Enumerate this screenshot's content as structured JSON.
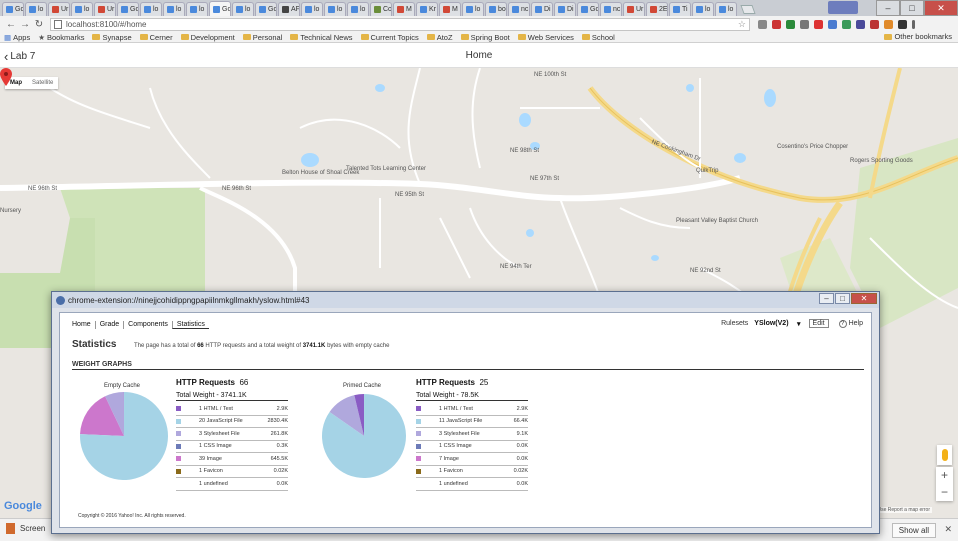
{
  "browser": {
    "tabs": [
      {
        "label": "Go",
        "color": "#4a89dc"
      },
      {
        "label": "lo",
        "color": "#4a89dc"
      },
      {
        "label": "Ur",
        "color": "#d14836"
      },
      {
        "label": "lo",
        "color": "#4a89dc"
      },
      {
        "label": "Ur",
        "color": "#d14836"
      },
      {
        "label": "Go",
        "color": "#4a89dc"
      },
      {
        "label": "lo",
        "color": "#4a89dc"
      },
      {
        "label": "lo",
        "color": "#4a89dc"
      },
      {
        "label": "lo",
        "color": "#4a89dc"
      },
      {
        "label": "Go",
        "color": "#4a89dc"
      },
      {
        "label": "lo",
        "color": "#4a89dc"
      },
      {
        "label": "Go",
        "color": "#4a89dc"
      },
      {
        "label": "AF",
        "color": "#444444"
      },
      {
        "label": "lo",
        "color": "#4a89dc"
      },
      {
        "label": "lo",
        "color": "#4a89dc"
      },
      {
        "label": "lo",
        "color": "#4a89dc"
      },
      {
        "label": "Co",
        "color": "#6a8e3a"
      },
      {
        "label": "M",
        "color": "#d14836"
      },
      {
        "label": "Kr",
        "color": "#4a89dc"
      },
      {
        "label": "M",
        "color": "#d14836"
      },
      {
        "label": "lo",
        "color": "#4a89dc"
      },
      {
        "label": "bo",
        "color": "#4a89dc"
      },
      {
        "label": "nc",
        "color": "#4a89dc"
      },
      {
        "label": "Di",
        "color": "#4a89dc"
      },
      {
        "label": "Di",
        "color": "#4a89dc"
      },
      {
        "label": "Go",
        "color": "#4a89dc"
      },
      {
        "label": "nc",
        "color": "#4a89dc"
      },
      {
        "label": "Ur",
        "color": "#d14836"
      },
      {
        "label": "2E",
        "color": "#d14836"
      },
      {
        "label": "Ti",
        "color": "#4a89dc"
      },
      {
        "label": "lo",
        "color": "#4a89dc"
      },
      {
        "label": "lo",
        "color": "#4a89dc"
      }
    ],
    "url": "localhost:8100/#/home",
    "bookmarks": [
      "Apps",
      "Bookmarks",
      "Synapse",
      "Cerner",
      "Development",
      "Personal",
      "Technical News",
      "Current Topics",
      "AtoZ",
      "Spring Boot",
      "Web Services",
      "School"
    ],
    "other_bookmarks": "Other bookmarks"
  },
  "app": {
    "back_label": "Lab 7",
    "title": "Home"
  },
  "map": {
    "type_map": "Map",
    "type_satellite": "Satellite",
    "zoom_in": "+",
    "zoom_out": "−",
    "google": "Google",
    "footer": "Map data ©2016 Google   Terms of Use   Report a map error",
    "streets": [
      "NE 100th St",
      "NE 96th St",
      "NE 96th St",
      "NE 95th St",
      "NE 98th St",
      "NE 97th St",
      "NE 94th Ter",
      "NE 92nd St",
      "NE Cookingham Dr",
      "N Main St",
      "N Flintlock Rd",
      "NE 99th St",
      "Shoal Creek"
    ],
    "places": [
      "Belton House of Shoal Creek",
      "Talented Tots Learning Center",
      "QuikTrip",
      "Cosentino's Price Chopper",
      "Rogers Sporting Goods",
      "Pleasant Valley Baptist Church",
      "Nursery"
    ]
  },
  "download_bar": {
    "item": "Screen",
    "show_all": "Show all"
  },
  "popup": {
    "title": "chrome-extension://ninejjcohidippngpapiilnmkgllmakh/yslow.html#43",
    "menu": [
      "Home",
      "Grade",
      "Components",
      "Statistics"
    ],
    "rulesets_label": "Rulesets",
    "ruleset": "YSlow(V2)",
    "edit": "Edit",
    "help": "Help",
    "stats_title": "Statistics",
    "stats_desc_pre": "The page has a total of",
    "stats_desc_req": "66",
    "stats_desc_mid": "HTTP requests and a total weight of",
    "stats_desc_wt": "3741.1K",
    "stats_desc_post": "bytes with empty cache",
    "weight_graphs": "WEIGHT GRAPHS",
    "copyright": "Copyright © 2016 Yahoo! Inc. All rights reserved."
  },
  "empty_cache": {
    "label": "Empty Cache",
    "http_label": "HTTP Requests",
    "http_value": "66",
    "total_weight": "Total Weight - 3741.1K",
    "rows": [
      {
        "name": "1 HTML / Text",
        "value": "2.9K",
        "color": "#8a5cc4"
      },
      {
        "name": "20 JavaScript File",
        "value": "2830.4K",
        "color": "#a5d3e6"
      },
      {
        "name": "3 Stylesheet File",
        "value": "261.8K",
        "color": "#b0a8dd"
      },
      {
        "name": "1 CSS Image",
        "value": "0.3K",
        "color": "#6d7bb8"
      },
      {
        "name": "39 Image",
        "value": "645.5K",
        "color": "#cc77cc"
      },
      {
        "name": "1 Favicon",
        "value": "0.02K",
        "color": "#8a6a1a"
      },
      {
        "name": "1 undefined",
        "value": "0.0K",
        "color": "#ffffff"
      }
    ]
  },
  "primed_cache": {
    "label": "Primed Cache",
    "http_label": "HTTP Requests",
    "http_value": "25",
    "total_weight": "Total Weight - 78.5K",
    "rows": [
      {
        "name": "1 HTML / Text",
        "value": "2.9K",
        "color": "#8a5cc4"
      },
      {
        "name": "11 JavaScript File",
        "value": "66.4K",
        "color": "#a5d3e6"
      },
      {
        "name": "3 Stylesheet File",
        "value": "9.1K",
        "color": "#b0a8dd"
      },
      {
        "name": "1 CSS Image",
        "value": "0.0K",
        "color": "#6d7bb8"
      },
      {
        "name": "7 Image",
        "value": "0.0K",
        "color": "#cc77cc"
      },
      {
        "name": "1 Favicon",
        "value": "0.02K",
        "color": "#8a6a1a"
      },
      {
        "name": "1 undefined",
        "value": "0.0K",
        "color": "#ffffff"
      }
    ]
  },
  "chart_data": [
    {
      "type": "pie",
      "title": "Empty Cache",
      "categories": [
        "HTML / Text",
        "JavaScript File",
        "Stylesheet File",
        "CSS Image",
        "Image",
        "Favicon",
        "undefined"
      ],
      "values": [
        2.9,
        2830.4,
        261.8,
        0.3,
        645.5,
        0.02,
        0.0
      ],
      "colors": [
        "#8a5cc4",
        "#a5d3e6",
        "#b0a8dd",
        "#6d7bb8",
        "#cc77cc",
        "#8a6a1a",
        "#ffffff"
      ]
    },
    {
      "type": "pie",
      "title": "Primed Cache",
      "categories": [
        "HTML / Text",
        "JavaScript File",
        "Stylesheet File",
        "CSS Image",
        "Image",
        "Favicon",
        "undefined"
      ],
      "values": [
        2.9,
        66.4,
        9.1,
        0.0,
        0.0,
        0.02,
        0.0
      ],
      "colors": [
        "#8a5cc4",
        "#a5d3e6",
        "#b0a8dd",
        "#6d7bb8",
        "#cc77cc",
        "#8a6a1a",
        "#ffffff"
      ]
    }
  ]
}
